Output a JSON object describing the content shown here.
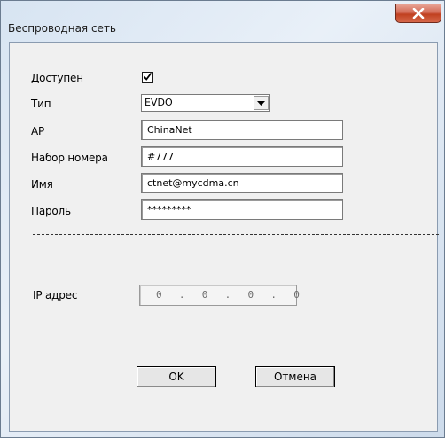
{
  "window": {
    "title": "Беспроводная сеть"
  },
  "form": {
    "enabled_label": "Доступен",
    "enabled_checked": true,
    "type_label": "Тип",
    "type_value": "EVDO",
    "ap_label": "AP",
    "ap_value": "ChinaNet",
    "dial_label": "Набор номера",
    "dial_value": "#777",
    "user_label": "Имя",
    "user_value": "ctnet@mycdma.cn",
    "password_label": "Пароль",
    "password_value": "*********",
    "ip_label": "IP адрес",
    "ip_value": "0  .  0  .  0  .  0"
  },
  "buttons": {
    "ok_label": "OK",
    "cancel_label": "Отмена"
  },
  "icons": {
    "close": "close-icon",
    "check": "checkmark-icon",
    "dropdown": "chevron-down-icon"
  },
  "colors": {
    "close_button": "#c0401f",
    "dialog_bg": "#f0f0f0",
    "frame": "#d7e4f2"
  }
}
